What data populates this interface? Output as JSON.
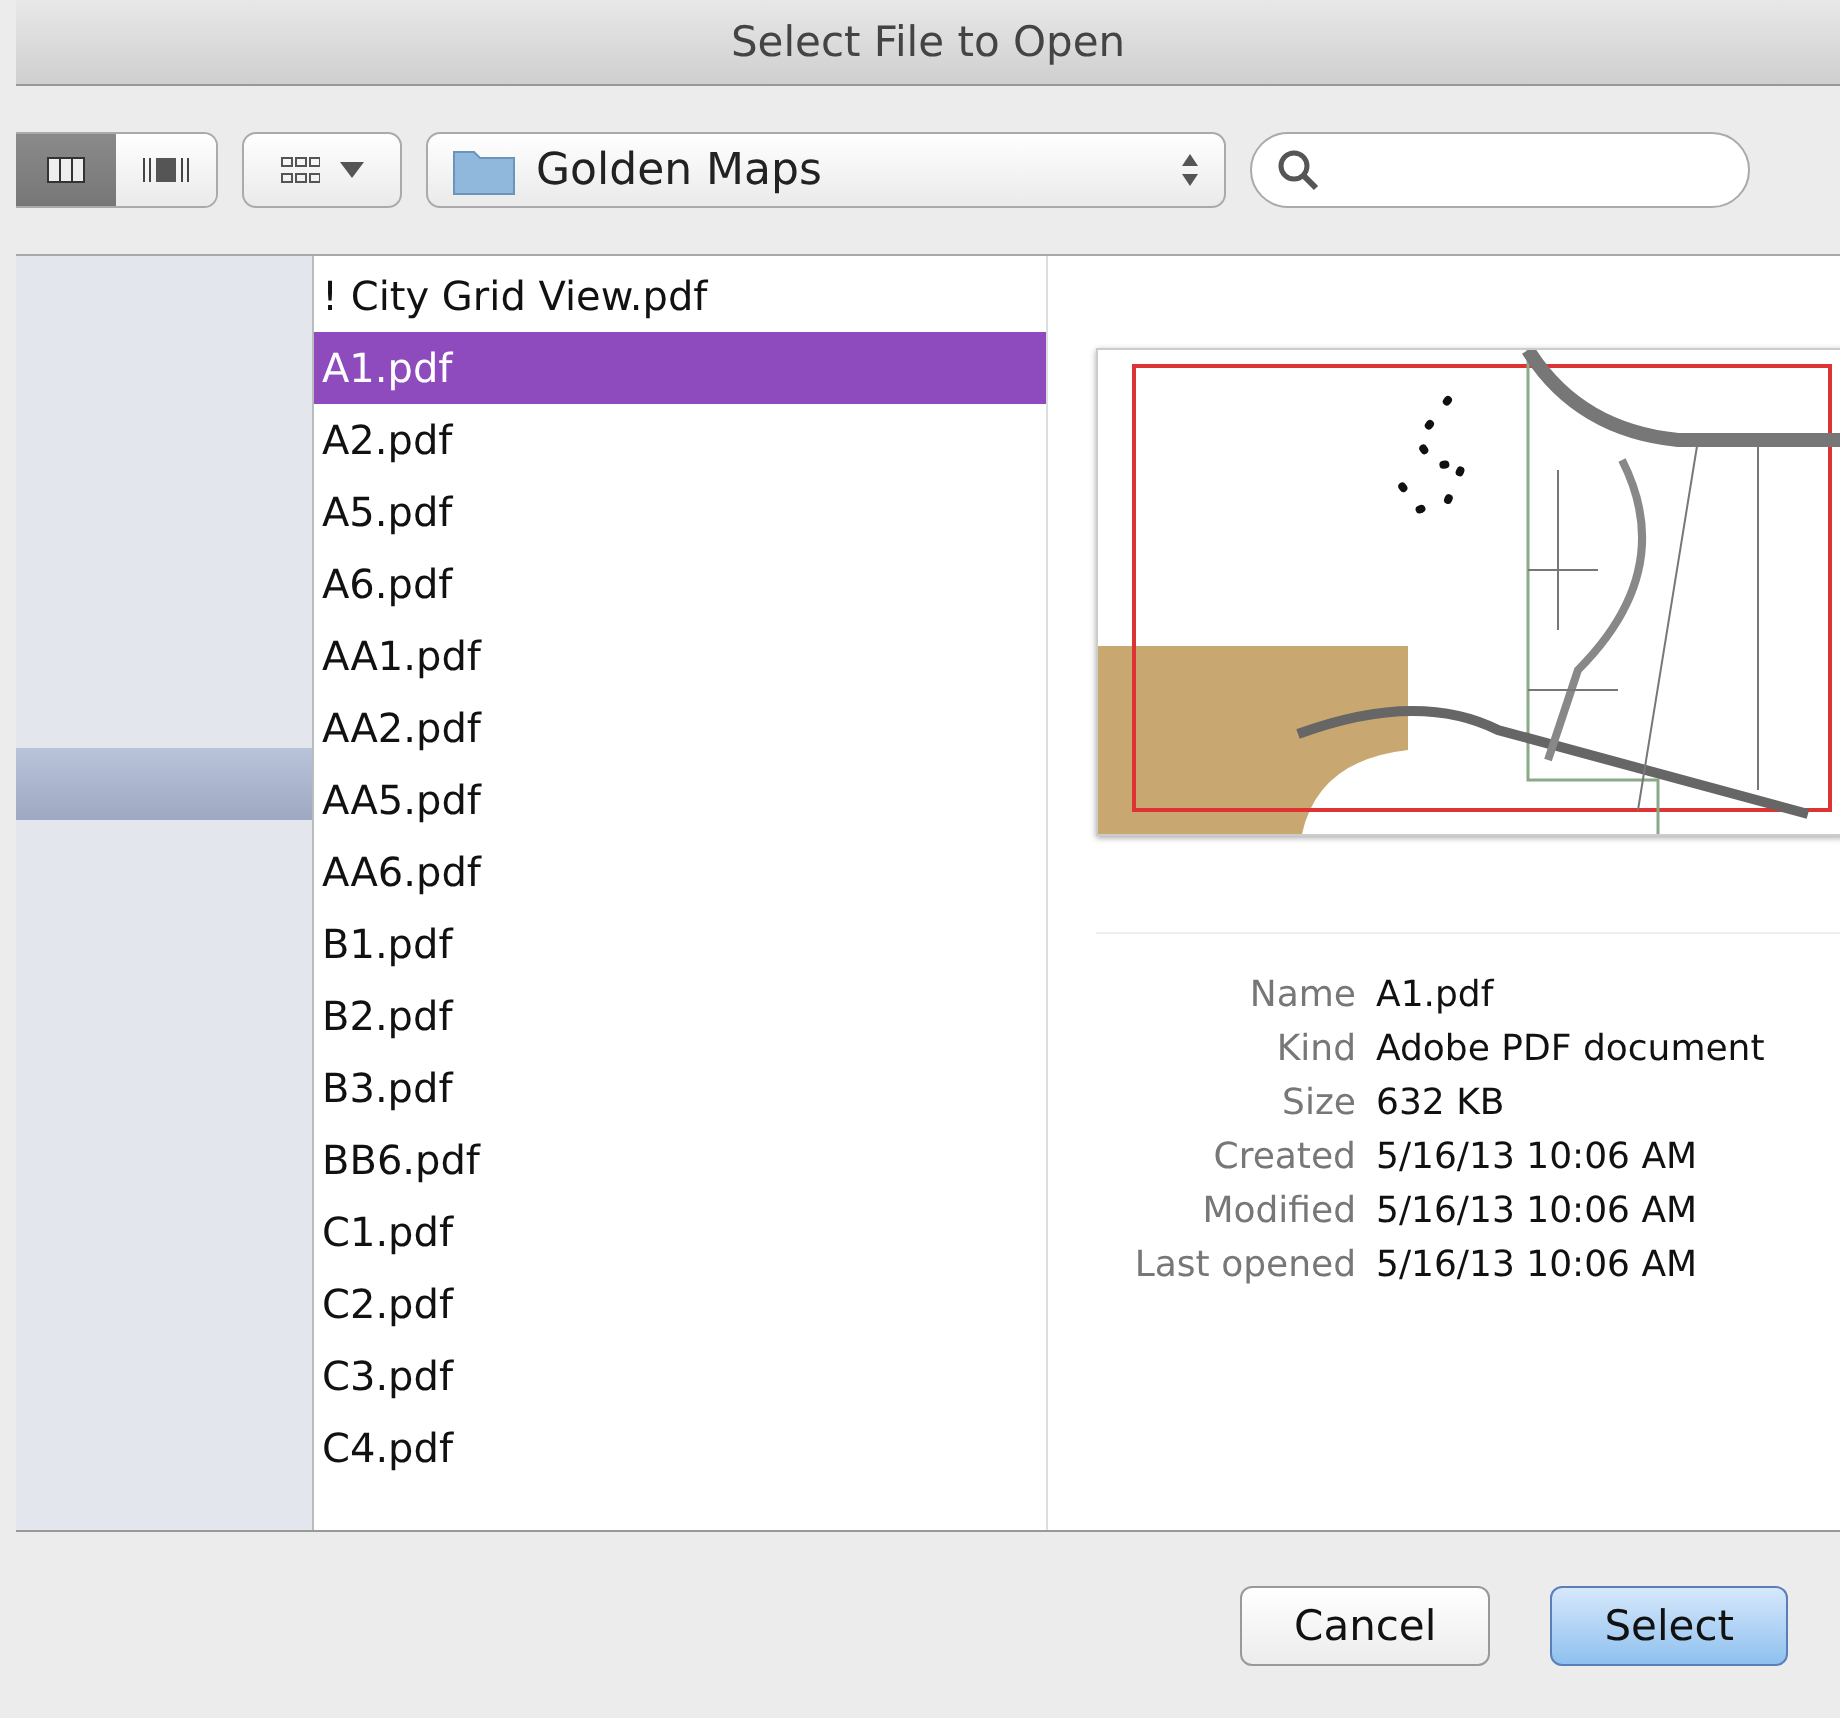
{
  "window": {
    "title": "Select File to Open"
  },
  "toolbar": {
    "view_buttons": [
      {
        "kind": "columns",
        "selected": true
      },
      {
        "kind": "coverflow",
        "selected": false
      }
    ],
    "location": "Golden Maps"
  },
  "sidebar": {
    "items": [
      {
        "selected": true
      }
    ]
  },
  "files": [
    {
      "name": "! City Grid View.pdf",
      "selected": false
    },
    {
      "name": "A1.pdf",
      "selected": true
    },
    {
      "name": "A2.pdf",
      "selected": false
    },
    {
      "name": "A5.pdf",
      "selected": false
    },
    {
      "name": "A6.pdf",
      "selected": false
    },
    {
      "name": "AA1.pdf",
      "selected": false
    },
    {
      "name": "AA2.pdf",
      "selected": false
    },
    {
      "name": "AA5.pdf",
      "selected": false
    },
    {
      "name": "AA6.pdf",
      "selected": false
    },
    {
      "name": "B1.pdf",
      "selected": false
    },
    {
      "name": "B2.pdf",
      "selected": false
    },
    {
      "name": "B3.pdf",
      "selected": false
    },
    {
      "name": "BB6.pdf",
      "selected": false
    },
    {
      "name": "C1.pdf",
      "selected": false
    },
    {
      "name": "C2.pdf",
      "selected": false
    },
    {
      "name": "C3.pdf",
      "selected": false
    },
    {
      "name": "C4.pdf",
      "selected": false
    }
  ],
  "preview": {
    "kind": "picture",
    "info": [
      {
        "label": "Name",
        "value": "A1.pdf"
      },
      {
        "label": "Kind",
        "value": "Adobe PDF document"
      },
      {
        "label": "Size",
        "value": "632 KB"
      },
      {
        "label": "Created",
        "value": "5/16/13 10:06 AM"
      },
      {
        "label": "Modified",
        "value": "5/16/13 10:06 AM"
      },
      {
        "label": "Last opened",
        "value": "5/16/13 10:06 AM"
      }
    ]
  },
  "buttons": [
    {
      "label": "Cancel",
      "default": false
    },
    {
      "label": "Select",
      "default": true
    }
  ]
}
